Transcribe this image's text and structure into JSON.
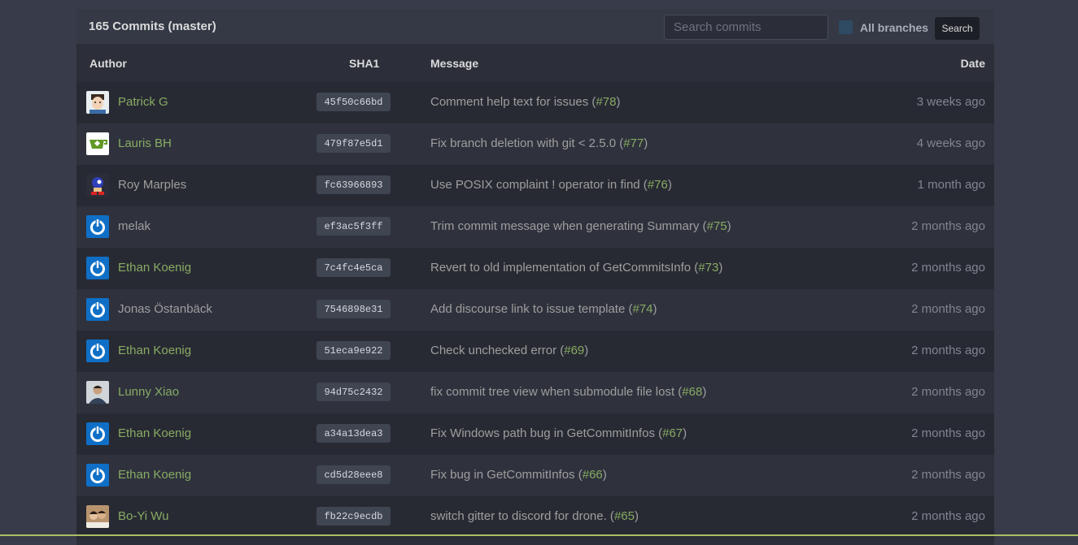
{
  "header": {
    "title": "165 Commits (master)",
    "search_placeholder": "Search commits",
    "all_branches_label": "All branches",
    "search_button": "Search"
  },
  "columns": {
    "author": "Author",
    "sha": "SHA1",
    "message": "Message",
    "date": "Date"
  },
  "colors": {
    "link_green": "#87ab63",
    "avatar_blue": "#0f6fc6"
  },
  "commits": [
    {
      "author": "Patrick G",
      "linked": true,
      "avatar": "cartoon-face",
      "sha": "45f50c66bd",
      "message": "Comment help text for issues (",
      "issue": "#78",
      "tail": ")",
      "date": "3 weeks ago"
    },
    {
      "author": "Lauris BH",
      "linked": true,
      "avatar": "gitea-teacup",
      "sha": "479f87e5d1",
      "message": "Fix branch deletion with git < 2.5.0 (",
      "issue": "#77",
      "tail": ")",
      "date": "4 weeks ago"
    },
    {
      "author": "Roy Marples",
      "linked": false,
      "avatar": "sonic-sprite",
      "sha": "fc63966893",
      "message": "Use POSIX complaint ! operator in find (",
      "issue": "#76",
      "tail": ")",
      "date": "1 month ago"
    },
    {
      "author": "melak",
      "linked": false,
      "avatar": "power-icon",
      "sha": "ef3ac5f3ff",
      "message": "Trim commit message when generating Summary (",
      "issue": "#75",
      "tail": ")",
      "date": "2 months ago"
    },
    {
      "author": "Ethan Koenig",
      "linked": true,
      "avatar": "power-icon",
      "sha": "7c4fc4e5ca",
      "message": "Revert to old implementation of GetCommitsInfo (",
      "issue": "#73",
      "tail": ")",
      "date": "2 months ago"
    },
    {
      "author": "Jonas Östanbäck",
      "linked": false,
      "avatar": "power-icon",
      "sha": "7546898e31",
      "message": "Add discourse link to issue template (",
      "issue": "#74",
      "tail": ")",
      "date": "2 months ago"
    },
    {
      "author": "Ethan Koenig",
      "linked": true,
      "avatar": "power-icon",
      "sha": "51eca9e922",
      "message": "Check unchecked error (",
      "issue": "#69",
      "tail": ")",
      "date": "2 months ago"
    },
    {
      "author": "Lunny Xiao",
      "linked": true,
      "avatar": "photo-person",
      "sha": "94d75c2432",
      "message": "fix commit tree view when submodule file lost (",
      "issue": "#68",
      "tail": ")",
      "date": "2 months ago"
    },
    {
      "author": "Ethan Koenig",
      "linked": true,
      "avatar": "power-icon",
      "sha": "a34a13dea3",
      "message": "Fix Windows path bug in GetCommitInfos (",
      "issue": "#67",
      "tail": ")",
      "date": "2 months ago"
    },
    {
      "author": "Ethan Koenig",
      "linked": true,
      "avatar": "power-icon",
      "sha": "cd5d28eee8",
      "message": "Fix bug in GetCommitInfos (",
      "issue": "#66",
      "tail": ")",
      "date": "2 months ago"
    },
    {
      "author": "Bo-Yi Wu",
      "linked": true,
      "avatar": "photo-couple",
      "sha": "fb22c9ecdb",
      "message": "switch gitter to discord for drone. (",
      "issue": "#65",
      "tail": ")",
      "date": "2 months ago"
    }
  ]
}
